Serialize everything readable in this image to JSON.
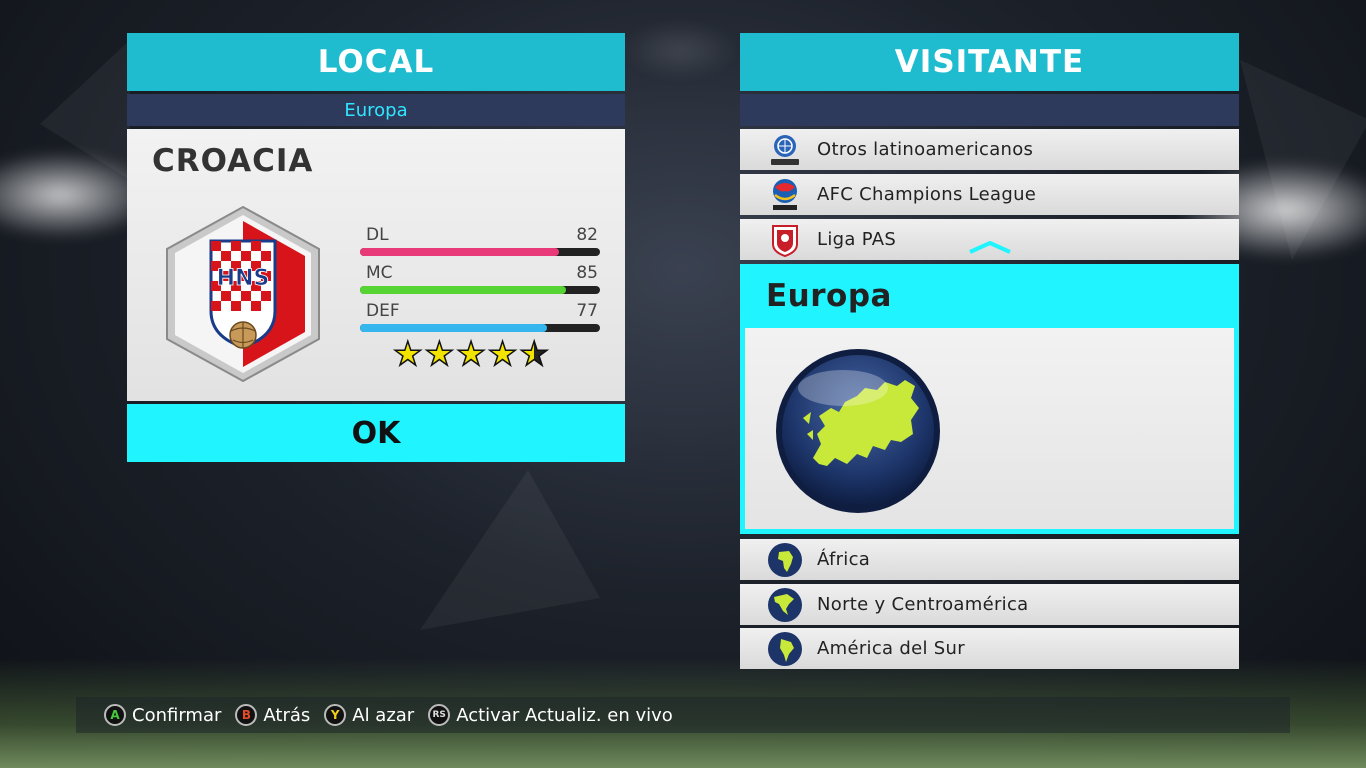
{
  "local": {
    "header": "LOCAL",
    "region": "Europa",
    "team": {
      "name": "CROACIA",
      "crest_text": "HNS",
      "stats": [
        {
          "label": "DL",
          "value": 82,
          "color": "#e83a78"
        },
        {
          "label": "MC",
          "value": 85,
          "color": "#55d433"
        },
        {
          "label": "DEF",
          "value": 77,
          "color": "#35b6ef"
        }
      ],
      "stars": 4.5
    },
    "ok_label": "OK"
  },
  "visitante": {
    "header": "VISITANTE",
    "items_above": [
      {
        "label": "Otros latinoamericanos",
        "icon": "conmebol-icon"
      },
      {
        "label": "AFC Champions League",
        "icon": "afc-champions-league-icon"
      },
      {
        "label": "Liga PAS",
        "icon": "liga-pas-icon"
      }
    ],
    "selected": {
      "label": "Europa",
      "icon": "europe-globe-icon"
    },
    "items_below": [
      {
        "label": "África",
        "icon": "africa-globe-icon"
      },
      {
        "label": "Norte y Centroamérica",
        "icon": "north-america-globe-icon"
      },
      {
        "label": "América del Sur",
        "icon": "south-america-globe-icon"
      }
    ]
  },
  "footer": {
    "hints": [
      {
        "button": "A",
        "color": "#45c93a",
        "label": "Confirmar"
      },
      {
        "button": "B",
        "color": "#e24a2a",
        "label": "Atrás"
      },
      {
        "button": "Y",
        "color": "#f2cc1a",
        "label": "Al azar"
      },
      {
        "button": "RS",
        "color": "#dddddd",
        "label": "Activar Actualiz. en vivo"
      }
    ]
  }
}
